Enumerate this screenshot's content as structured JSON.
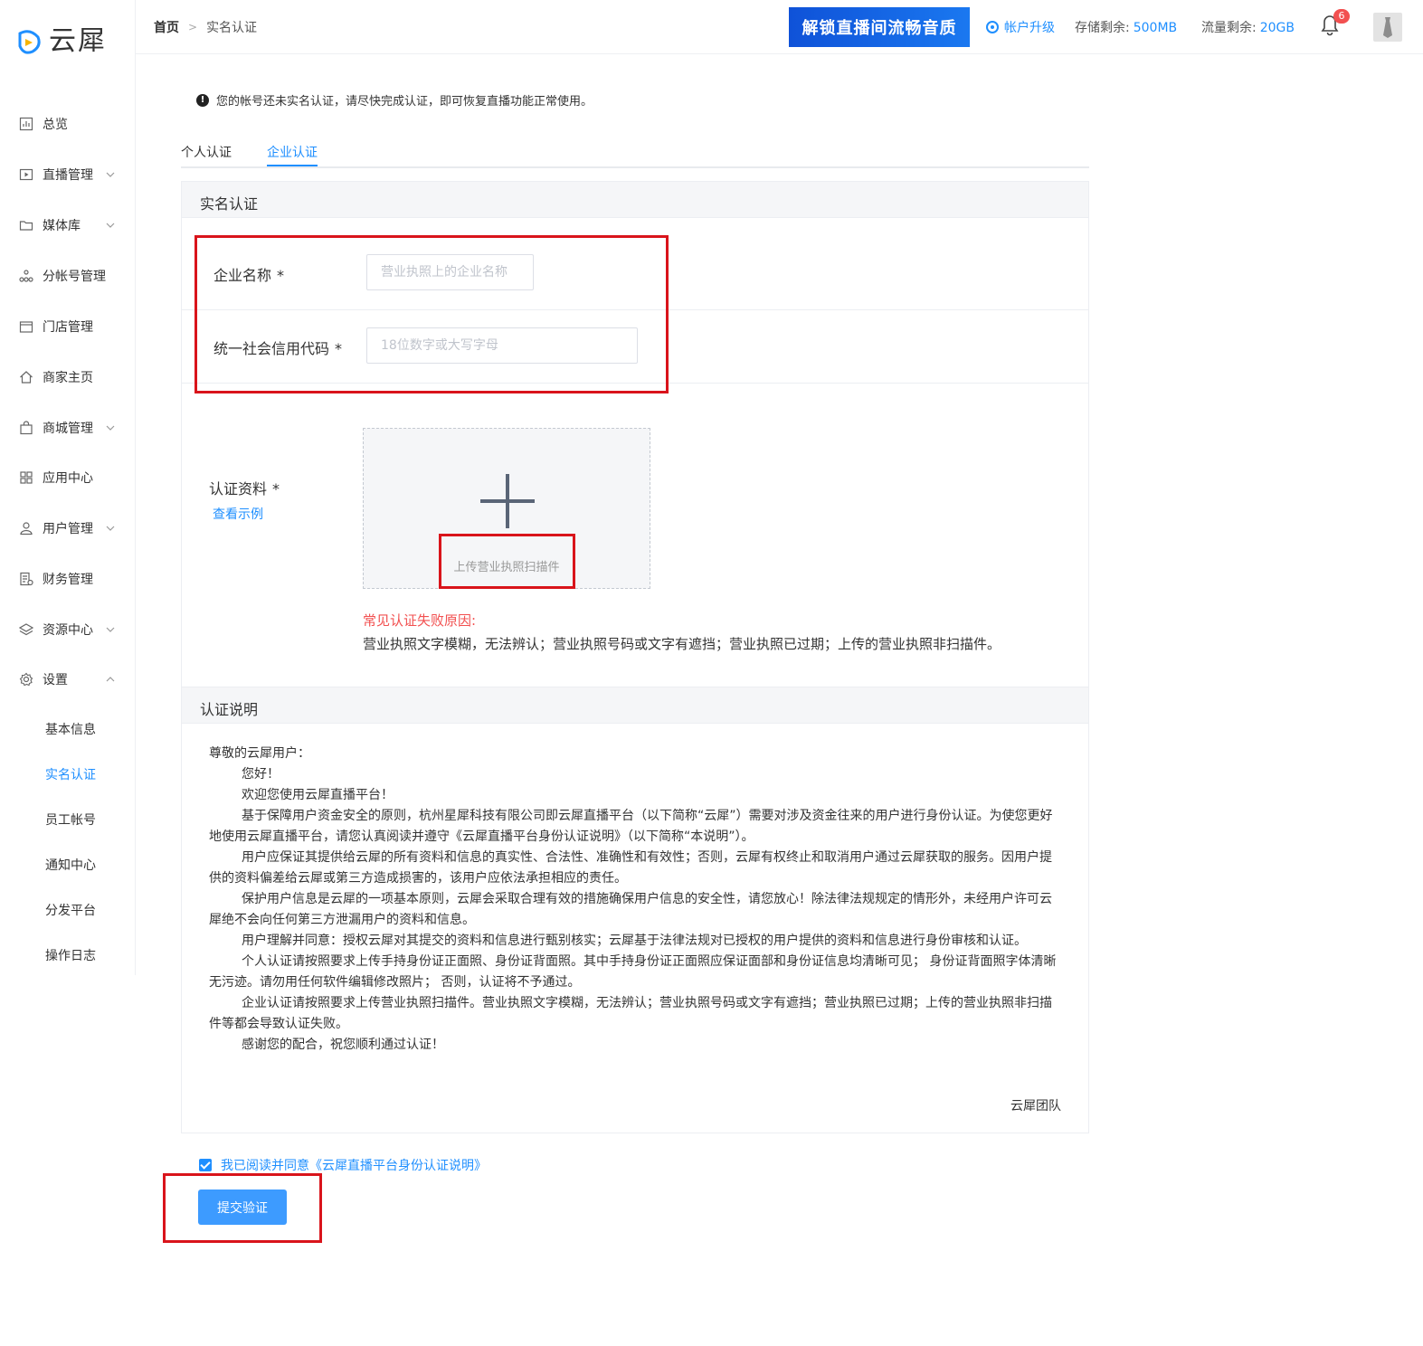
{
  "app": {
    "logo_text": "云犀",
    "brand_color": "#1f8fff"
  },
  "sidebar": {
    "items": [
      {
        "label": "总览",
        "icon": "chart-icon",
        "expandable": false
      },
      {
        "label": "直播管理",
        "icon": "play-icon",
        "expandable": true
      },
      {
        "label": "媒体库",
        "icon": "folder-icon",
        "expandable": true
      },
      {
        "label": "分帐号管理",
        "icon": "org-icon",
        "expandable": false
      },
      {
        "label": "门店管理",
        "icon": "store-icon",
        "expandable": false
      },
      {
        "label": "商家主页",
        "icon": "home-icon",
        "expandable": false
      },
      {
        "label": "商城管理",
        "icon": "bag-icon",
        "expandable": true
      },
      {
        "label": "应用中心",
        "icon": "grid-icon",
        "expandable": false
      },
      {
        "label": "用户管理",
        "icon": "user-icon",
        "expandable": true
      },
      {
        "label": "财务管理",
        "icon": "finance-icon",
        "expandable": false
      },
      {
        "label": "资源中心",
        "icon": "layers-icon",
        "expandable": true
      },
      {
        "label": "设置",
        "icon": "gear-icon",
        "expandable": true,
        "expanded": true
      }
    ],
    "settings_sub": [
      "基本信息",
      "实名认证",
      "员工帐号",
      "通知中心",
      "分发平台",
      "操作日志"
    ],
    "active_sub": "实名认证"
  },
  "header": {
    "breadcrumb_home": "首页",
    "breadcrumb_current": "实名认证",
    "banner_text": "解锁直播间流畅音质",
    "upgrade_label": "帐户升级",
    "storage_label": "存储剩余:",
    "storage_value": "500MB",
    "traffic_label": "流量剩余:",
    "traffic_value": "20GB",
    "notification_count": "6"
  },
  "notice": "您的帐号还未实名认证，请尽快完成认证，即可恢复直播功能正常使用。",
  "tabs": [
    {
      "label": "个人认证",
      "active": false
    },
    {
      "label": "企业认证",
      "active": true
    }
  ],
  "form": {
    "section_title": "实名认证",
    "company_name_label": "企业名称",
    "company_name_placeholder": "营业执照上的企业名称",
    "credit_code_label": "统一社会信用代码",
    "credit_code_placeholder": "18位数字或大写字母",
    "required_mark": "*",
    "material_label": "认证资料",
    "view_example": "查看示例",
    "upload_hint": "上传营业执照扫描件",
    "fail_title": "常见认证失败原因:",
    "fail_body": "营业执照文字模糊，无法辨认；营业执照号码或文字有遮挡；营业执照已过期；上传的营业执照非扫描件。"
  },
  "explanation": {
    "title": "认证说明",
    "greeting": "尊敬的云犀用户：",
    "hello": "您好！",
    "welcome": "欢迎您使用云犀直播平台！",
    "paragraphs": [
      "基于保障用户资金安全的原则，杭州星犀科技有限公司即云犀直播平台（以下简称“云犀”）需要对涉及资金往来的用户进行身份认证。为使您更好地使用云犀直播平台，请您认真阅读并遵守《云犀直播平台身份认证说明》（以下简称“本说明”）。",
      "用户应保证其提供给云犀的所有资料和信息的真实性、合法性、准确性和有效性；否则，云犀有权终止和取消用户通过云犀获取的服务。因用户提供的资料偏差给云犀或第三方造成损害的，该用户应依法承担相应的责任。",
      "保护用户信息是云犀的一项基本原则，云犀会采取合理有效的措施确保用户信息的安全性，请您放心！除法律法规规定的情形外，未经用户许可云犀绝不会向任何第三方泄漏用户的资料和信息。",
      "用户理解并同意：授权云犀对其提交的资料和信息进行甄别核实；云犀基于法律法规对已授权的用户提供的资料和信息进行身份审核和认证。",
      "个人认证请按照要求上传手持身份证正面照、身份证背面照。其中手持身份证正面照应保证面部和身份证信息均清晰可见； 身份证背面照字体清晰无污迹。请勿用任何软件编辑修改照片； 否则，认证将不予通过。",
      "企业认证请按照要求上传营业执照扫描件。营业执照文字模糊，无法辨认；营业执照号码或文字有遮挡；营业执照已过期；上传的营业执照非扫描件等都会导致认证失败。"
    ],
    "thanks": "感谢您的配合，祝您顺利通过认证！",
    "signature": "云犀团队"
  },
  "agreement": {
    "checked": true,
    "label": "我已阅读并同意《云犀直播平台身份认证说明》"
  },
  "submit_label": "提交验证"
}
